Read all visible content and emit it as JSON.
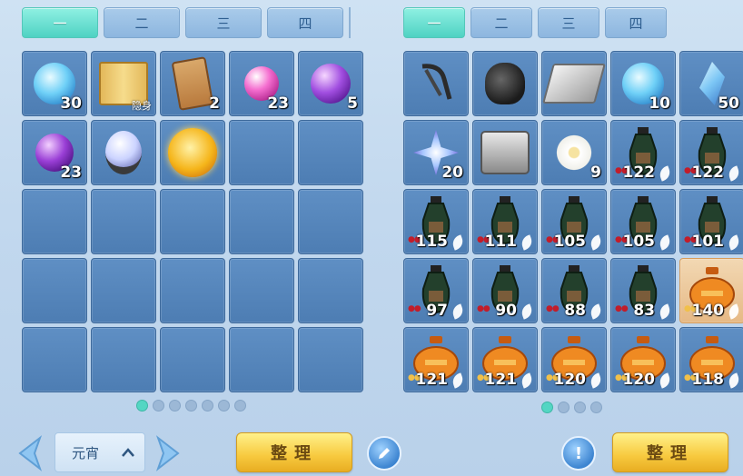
{
  "left_panel": {
    "tabs": [
      "一",
      "二",
      "三",
      "四"
    ],
    "active_tab": 0,
    "items": [
      {
        "icon": "blue-swirl-orb-icon",
        "count": "30"
      },
      {
        "icon": "map-scroll-icon",
        "count": "",
        "sub": "隐身"
      },
      {
        "icon": "scroll-icon",
        "count": "2"
      },
      {
        "icon": "pink-pearl-icon",
        "count": "23"
      },
      {
        "icon": "purple-pearl-icon",
        "count": "5"
      },
      {
        "icon": "purple-orb-on-cloth-icon",
        "count": "23"
      },
      {
        "icon": "crystal-ball-stand-icon",
        "count": ""
      },
      {
        "icon": "golden-coin-orb-icon",
        "count": ""
      }
    ],
    "pages": 7,
    "active_page": 0
  },
  "right_panel": {
    "tabs": [
      "一",
      "二",
      "三",
      "四"
    ],
    "active_tab": 0,
    "items": [
      {
        "icon": "rope-harness-icon",
        "count": ""
      },
      {
        "icon": "black-pouch-icon",
        "count": ""
      },
      {
        "icon": "silver-bar-icon",
        "count": ""
      },
      {
        "icon": "blue-swirl-orb-icon",
        "count": "10"
      },
      {
        "icon": "blue-crystal-icon",
        "count": "50"
      },
      {
        "icon": "star-shard-icon",
        "count": "20"
      },
      {
        "icon": "silver-chest-icon",
        "count": ""
      },
      {
        "icon": "white-flower-icon",
        "count": "9"
      },
      {
        "icon": "green-wine-jar-icon",
        "count": "122",
        "leaf": true,
        "dots": "red"
      },
      {
        "icon": "green-wine-jar-icon",
        "count": "122",
        "leaf": true,
        "dots": "red"
      },
      {
        "icon": "green-wine-jar-icon",
        "count": "115",
        "leaf": true,
        "dots": "red"
      },
      {
        "icon": "green-wine-jar-icon",
        "count": "111",
        "leaf": true,
        "dots": "red"
      },
      {
        "icon": "green-wine-jar-icon",
        "count": "105",
        "leaf": true,
        "dots": "red"
      },
      {
        "icon": "green-wine-jar-icon",
        "count": "105",
        "leaf": true,
        "dots": "red"
      },
      {
        "icon": "green-wine-jar-icon",
        "count": "101",
        "leaf": true,
        "dots": "red"
      },
      {
        "icon": "green-wine-jar-icon",
        "count": "97",
        "leaf": true,
        "dots": "red"
      },
      {
        "icon": "green-wine-jar-icon",
        "count": "90",
        "leaf": true,
        "dots": "red"
      },
      {
        "icon": "green-wine-jar-icon",
        "count": "88",
        "leaf": true,
        "dots": "red"
      },
      {
        "icon": "green-wine-jar-icon",
        "count": "83",
        "leaf": true,
        "dots": "red"
      },
      {
        "icon": "orange-jar-icon",
        "count": "140",
        "leaf": true,
        "dots": "gold",
        "highlight": true
      },
      {
        "icon": "orange-jar-icon",
        "count": "121",
        "leaf": true,
        "dots": "gold"
      },
      {
        "icon": "orange-jar-icon",
        "count": "121",
        "leaf": true,
        "dots": "gold"
      },
      {
        "icon": "orange-jar-icon",
        "count": "120",
        "leaf": true,
        "dots": "gold"
      },
      {
        "icon": "orange-jar-icon",
        "count": "120",
        "leaf": true,
        "dots": "gold"
      },
      {
        "icon": "orange-jar-icon",
        "count": "118",
        "leaf": true,
        "dots": "gold"
      }
    ],
    "pages": 4,
    "active_page": 0
  },
  "bottom": {
    "dropdown_value": "元宵",
    "sort_left": "整理",
    "sort_right": "整理"
  },
  "colors": {
    "accent_tab": "#4fd2c3",
    "slot_blue": "#4d7db3",
    "button_gold": "#f7c93e"
  }
}
